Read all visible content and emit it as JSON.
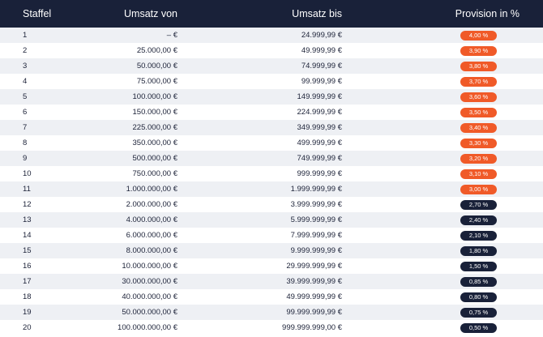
{
  "headers": {
    "staffel": "Staffel",
    "umsatz_von": "Umsatz von",
    "umsatz_bis": "Umsatz bis",
    "provision": "Provision in %"
  },
  "colors": {
    "header_bg": "#192139",
    "row_shade": "#eef0f4",
    "pill_orange": "#f05a28",
    "pill_navy": "#192139"
  },
  "rows": [
    {
      "staffel": "1",
      "von": "– €",
      "bis": "24.999,99 €",
      "provision": "4,00 %",
      "tier": "orange"
    },
    {
      "staffel": "2",
      "von": "25.000,00 €",
      "bis": "49.999,99 €",
      "provision": "3,90 %",
      "tier": "orange"
    },
    {
      "staffel": "3",
      "von": "50.000,00 €",
      "bis": "74.999,99 €",
      "provision": "3,80 %",
      "tier": "orange"
    },
    {
      "staffel": "4",
      "von": "75.000,00 €",
      "bis": "99.999,99 €",
      "provision": "3,70 %",
      "tier": "orange"
    },
    {
      "staffel": "5",
      "von": "100.000,00 €",
      "bis": "149.999,99 €",
      "provision": "3,60 %",
      "tier": "orange"
    },
    {
      "staffel": "6",
      "von": "150.000,00 €",
      "bis": "224.999,99 €",
      "provision": "3,50 %",
      "tier": "orange"
    },
    {
      "staffel": "7",
      "von": "225.000,00 €",
      "bis": "349.999,99 €",
      "provision": "3,40 %",
      "tier": "orange"
    },
    {
      "staffel": "8",
      "von": "350.000,00 €",
      "bis": "499.999,99 €",
      "provision": "3,30 %",
      "tier": "orange"
    },
    {
      "staffel": "9",
      "von": "500.000,00 €",
      "bis": "749.999,99 €",
      "provision": "3,20 %",
      "tier": "orange"
    },
    {
      "staffel": "10",
      "von": "750.000,00 €",
      "bis": "999.999,99 €",
      "provision": "3,10 %",
      "tier": "orange"
    },
    {
      "staffel": "11",
      "von": "1.000.000,00 €",
      "bis": "1.999.999,99 €",
      "provision": "3,00 %",
      "tier": "orange"
    },
    {
      "staffel": "12",
      "von": "2.000.000,00 €",
      "bis": "3.999.999,99 €",
      "provision": "2,70 %",
      "tier": "navy"
    },
    {
      "staffel": "13",
      "von": "4.000.000,00 €",
      "bis": "5.999.999,99 €",
      "provision": "2,40 %",
      "tier": "navy"
    },
    {
      "staffel": "14",
      "von": "6.000.000,00 €",
      "bis": "7.999.999,99 €",
      "provision": "2,10 %",
      "tier": "navy"
    },
    {
      "staffel": "15",
      "von": "8.000.000,00 €",
      "bis": "9.999.999,99 €",
      "provision": "1,80 %",
      "tier": "navy"
    },
    {
      "staffel": "16",
      "von": "10.000.000,00 €",
      "bis": "29.999.999,99 €",
      "provision": "1,50 %",
      "tier": "navy"
    },
    {
      "staffel": "17",
      "von": "30.000.000,00 €",
      "bis": "39.999.999,99 €",
      "provision": "0,85 %",
      "tier": "navy"
    },
    {
      "staffel": "18",
      "von": "40.000.000,00 €",
      "bis": "49.999.999,99 €",
      "provision": "0,80 %",
      "tier": "navy"
    },
    {
      "staffel": "19",
      "von": "50.000.000,00 €",
      "bis": "99.999.999,99 €",
      "provision": "0,75 %",
      "tier": "navy"
    },
    {
      "staffel": "20",
      "von": "100.000.000,00 €",
      "bis": "999.999.999,00 €",
      "provision": "0,50 %",
      "tier": "navy"
    }
  ]
}
